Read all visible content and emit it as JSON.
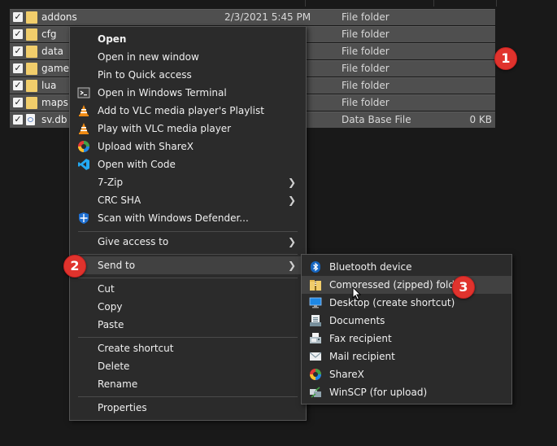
{
  "files": [
    {
      "name": "addons",
      "date": "2/3/2021 5:45 PM",
      "type": "File folder",
      "size": "",
      "icon": "folder-icon"
    },
    {
      "name": "cfg",
      "date": "",
      "type": "File folder",
      "size": "",
      "icon": "folder-icon"
    },
    {
      "name": "data",
      "date": "",
      "type": "File folder",
      "size": "",
      "icon": "folder-icon"
    },
    {
      "name": "gamem",
      "date": "",
      "type": "File folder",
      "size": "",
      "icon": "folder-icon"
    },
    {
      "name": "lua",
      "date": "",
      "type": "File folder",
      "size": "",
      "icon": "folder-icon"
    },
    {
      "name": "maps",
      "date": "",
      "type": "File folder",
      "size": "",
      "icon": "folder-icon"
    },
    {
      "name": "sv.db",
      "date": "",
      "type": "Data Base File",
      "size": "0 KB",
      "icon": "database-file-icon"
    }
  ],
  "context_menu": {
    "items": [
      {
        "label": "Open"
      },
      {
        "label": "Open in new window"
      },
      {
        "label": "Pin to Quick access"
      },
      {
        "label": "Open in Windows Terminal"
      },
      {
        "label": "Add to VLC media player's Playlist"
      },
      {
        "label": "Play with VLC media player"
      },
      {
        "label": "Upload with ShareX"
      },
      {
        "label": "Open with Code"
      },
      {
        "label": "7-Zip"
      },
      {
        "label": "CRC SHA"
      },
      {
        "label": "Scan with Windows Defender..."
      },
      {
        "label": "Give access to"
      },
      {
        "label": "Send to"
      },
      {
        "label": "Cut"
      },
      {
        "label": "Copy"
      },
      {
        "label": "Paste"
      },
      {
        "label": "Create shortcut"
      },
      {
        "label": "Delete"
      },
      {
        "label": "Rename"
      },
      {
        "label": "Properties"
      }
    ]
  },
  "sendto_menu": {
    "items": [
      {
        "label": "Bluetooth device"
      },
      {
        "label": "Compressed (zipped) folder"
      },
      {
        "label": "Desktop (create shortcut)"
      },
      {
        "label": "Documents"
      },
      {
        "label": "Fax recipient"
      },
      {
        "label": "Mail recipient"
      },
      {
        "label": "ShareX"
      },
      {
        "label": "WinSCP (for upload)"
      }
    ]
  },
  "annotations": {
    "step1": "1",
    "step2": "2",
    "step3": "3"
  },
  "colors": {
    "badge": "#e0332d",
    "highlight": "#414141",
    "menu_bg": "#2b2b2b",
    "folder": "#f1cd6b",
    "selected_row": "#4f4f4f"
  }
}
